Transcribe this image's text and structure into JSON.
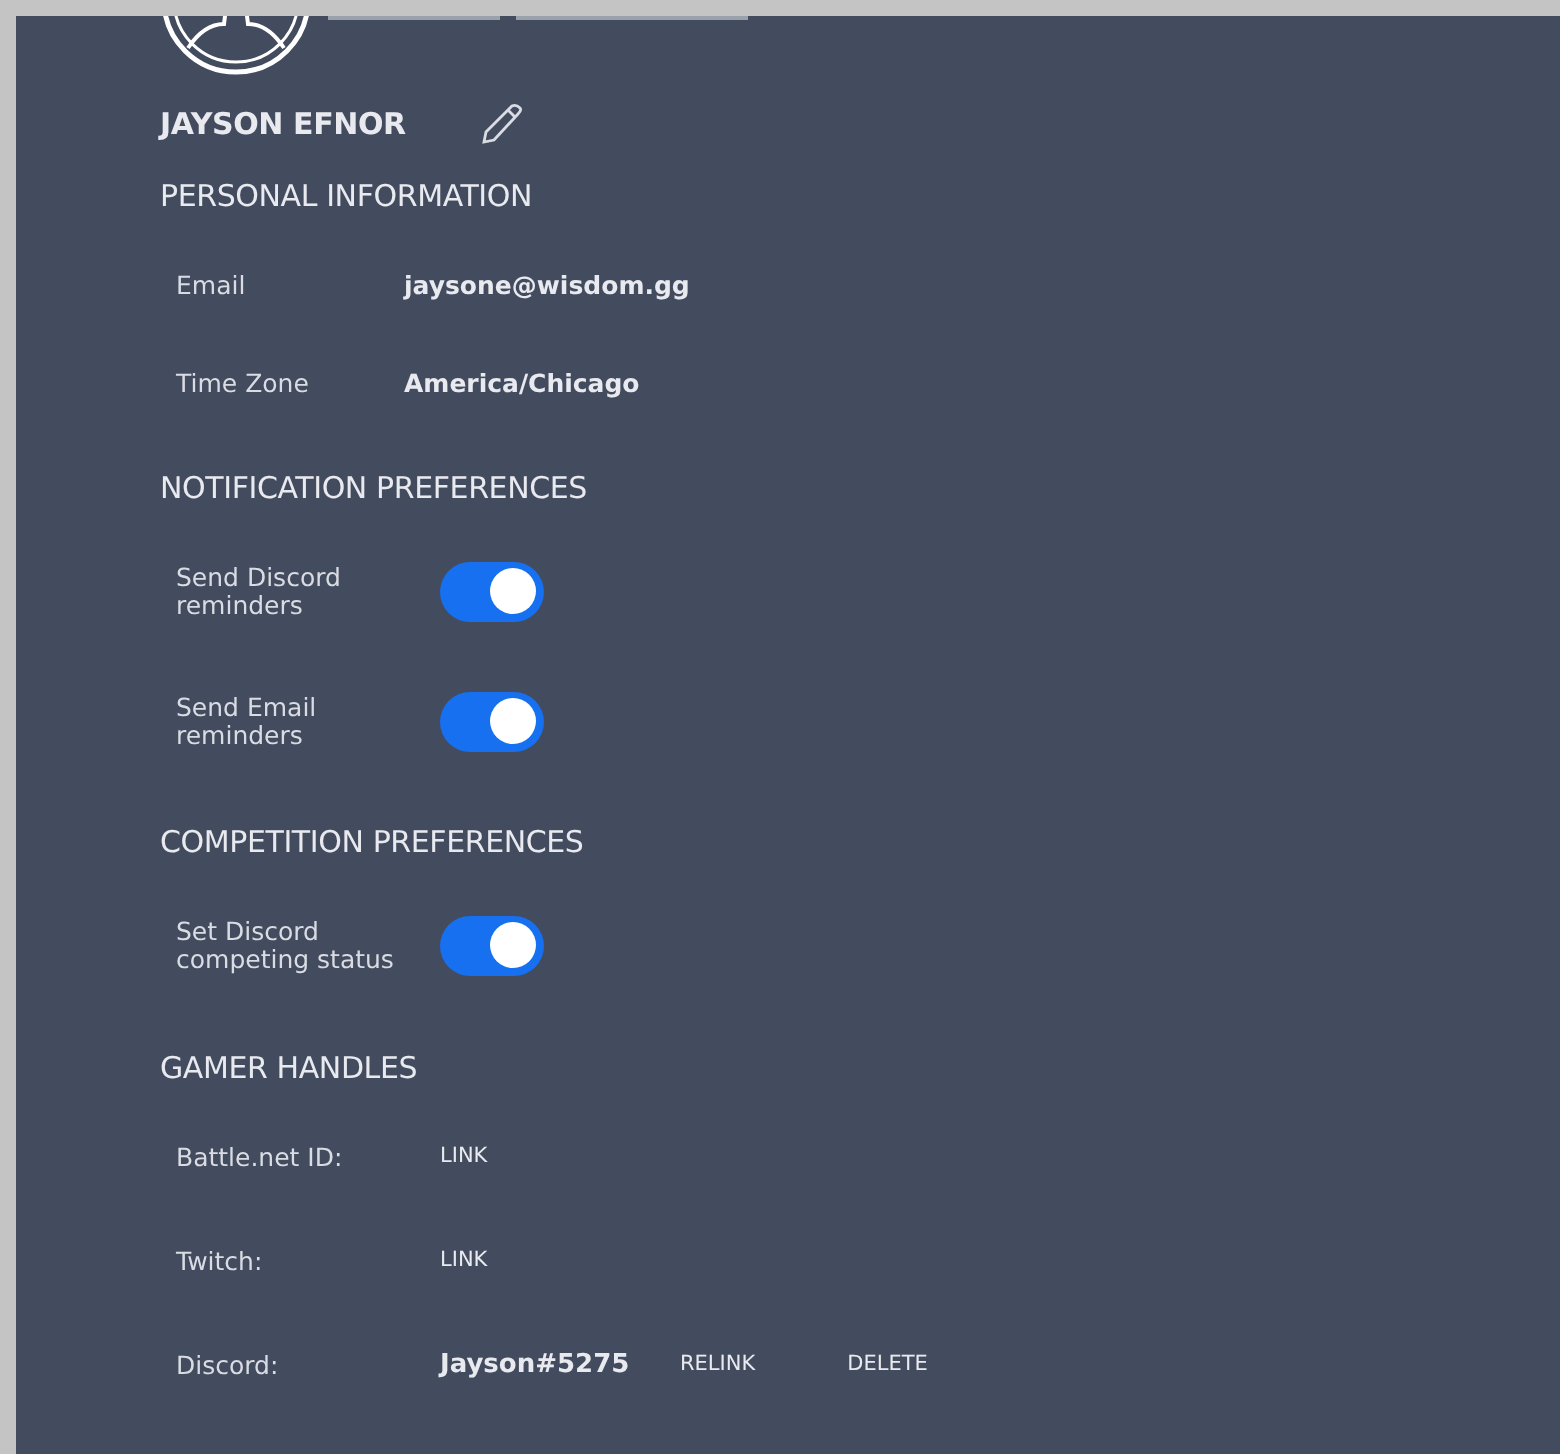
{
  "profile": {
    "name": "JAYSON EFNOR"
  },
  "personal_information": {
    "title": "PERSONAL INFORMATION",
    "fields": [
      {
        "label": "Email",
        "value": "jaysone@wisdom.gg"
      },
      {
        "label": "Time Zone",
        "value": "America/Chicago"
      }
    ]
  },
  "notification_preferences": {
    "title": "NOTIFICATION PREFERENCES",
    "toggles": [
      {
        "label": "Send Discord reminders",
        "on": true
      },
      {
        "label": "Send Email reminders",
        "on": true
      }
    ]
  },
  "competition_preferences": {
    "title": "COMPETITION PREFERENCES",
    "toggles": [
      {
        "label": "Set Discord competing status",
        "on": true
      }
    ]
  },
  "gamer_handles": {
    "title": "GAMER HANDLES",
    "handles": [
      {
        "label": "Battle.net ID:",
        "actions": [
          "LINK"
        ]
      },
      {
        "label": "Twitch:",
        "actions": [
          "LINK"
        ]
      },
      {
        "label": "Discord:",
        "value": "Jayson#5275",
        "actions": [
          "RELINK",
          "DELETE"
        ]
      }
    ]
  }
}
